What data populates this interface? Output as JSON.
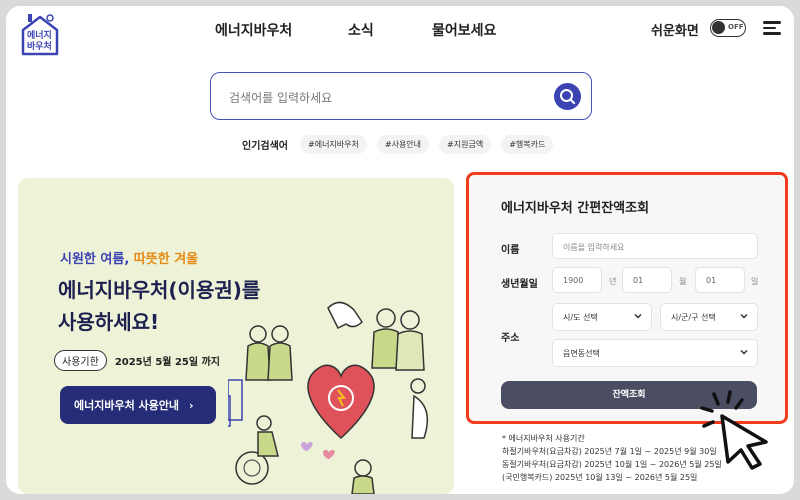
{
  "header": {
    "logo_text": "에너지바우처",
    "nav": [
      "에너지바우처",
      "소식",
      "물어보세요"
    ],
    "easy_view_label": "쉬운화면",
    "toggle_state": "OFF",
    "menu_icon": "hamburger-icon"
  },
  "search": {
    "placeholder": "검색어를 입력하세요",
    "icon": "search-icon",
    "popular_label": "인기검색어",
    "popular_tags": [
      "#에너지바우처",
      "#사용안내",
      "#지원금액",
      "#행복카드"
    ]
  },
  "banner": {
    "subtitle_part1": "시원한 여름,",
    "subtitle_part2": "따뜻한 겨울",
    "title_line1": "에너지바우처(이용권)를",
    "title_line2": "사용하세요!",
    "period_label": "사용기한",
    "period_value": "2025년 5월 25일 까지",
    "button_label": "에너지바우처 사용안내"
  },
  "balance": {
    "title": "에너지바우처 간편잔액조회",
    "name_label": "이름",
    "name_placeholder": "이름을 입력하세요",
    "birth_label": "생년월일",
    "year_value": "1900",
    "year_unit": "년",
    "month_value": "01",
    "month_unit": "월",
    "day_value": "01",
    "day_unit": "일",
    "address_label": "주소",
    "sido_select": "시/도 선택",
    "sigungu_select": "시/군/구 선택",
    "dong_select": "읍면동선택",
    "lookup_button": "잔액조회"
  },
  "notes": {
    "header": "* 에너지바우처 사용기간",
    "line1": "하절기바우처(요금차감) 2025년 7월 1일 ~ 2025년 9월 30일",
    "line2": "동절기바우처(요금차감) 2025년 10월 1일 ~ 2026년 5월 25일",
    "line3": "(국민행복카드) 2025년 10월 13일 ~ 2026년 5월 25일"
  },
  "colors": {
    "accent_blue": "#3b44b2",
    "navy": "#252c78",
    "highlight_border": "#f03b1d",
    "banner_bg": "#eef2d7",
    "orange": "#e58a12"
  }
}
